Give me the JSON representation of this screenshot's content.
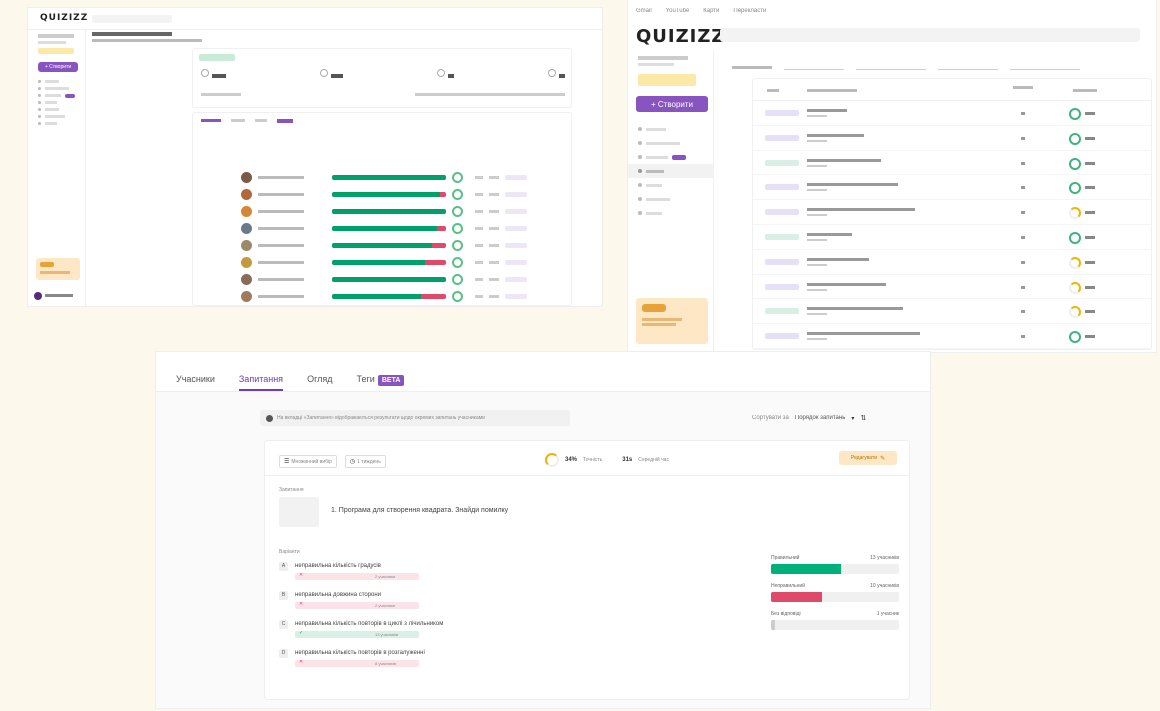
{
  "colors": {
    "brand": "#8854c0",
    "correct": "#00a06a",
    "incorrect": "#e04a6a",
    "background": "#fdf8ec"
  },
  "s1": {
    "logo": "QUIZIZZ",
    "create_label": "+ Створити",
    "students": [
      {
        "bar": 1.0
      },
      {
        "bar": 0.95
      },
      {
        "bar": 1.0
      },
      {
        "bar": 0.92
      },
      {
        "bar": 0.88
      },
      {
        "bar": 0.82
      },
      {
        "bar": 1.0
      },
      {
        "bar": 0.78
      }
    ]
  },
  "s2": {
    "bookmarks": [
      "Gmail",
      "YouTube",
      "Карти",
      "Перекласти"
    ],
    "logo": "QUIZIZZ",
    "create_label": "+ Створити",
    "rows": [
      {
        "acc": 0.9
      },
      {
        "acc": 0.85
      },
      {
        "acc": 0.9
      },
      {
        "acc": 0.85
      },
      {
        "acc": 0.5
      },
      {
        "acc": 0.9
      },
      {
        "acc": 0.55
      },
      {
        "acc": 0.45
      },
      {
        "acc": 0.5
      },
      {
        "acc": 0.95
      }
    ]
  },
  "s3": {
    "tabs": [
      {
        "label": "Учасники"
      },
      {
        "label": "Запитання"
      },
      {
        "label": "Огляд"
      },
      {
        "label": "Теги"
      }
    ],
    "beta": "BETA",
    "notice": "На вкладці «Запитання» відображаються результати щодо окремих запитань учасниками",
    "sort_label": "Сортувати за",
    "sort_value": "Порядок запитань",
    "qtype": "Множинний вибір",
    "qtime": "1 тиждень",
    "accuracy": "34%",
    "accuracy_label": "Точність",
    "avg_time": "31s",
    "avg_time_label": "Середній час",
    "edit_label": "Редагувати",
    "question_label": "Запитання",
    "question_text": "1. Програма для створення квадрата. Знайди помилку",
    "options_label": "Варіанти",
    "options": [
      {
        "letter": "A",
        "text": "неправильна кількість градусів",
        "count": "2 учасники"
      },
      {
        "letter": "B",
        "text": "неправильна довжина сторони",
        "count": "2 учасники"
      },
      {
        "letter": "C",
        "text": "неправильна кількість повторів в циклі з лічильником",
        "count": "13 учасників"
      },
      {
        "letter": "D",
        "text": "неправильна кількість повторів в розгалуженні",
        "count": "8 учасників"
      }
    ],
    "stats": [
      {
        "label": "Правильний",
        "count": "13 учасників"
      },
      {
        "label": "Неправильний",
        "count": "10 учасників"
      },
      {
        "label": "Без відповіді",
        "count": "1 учасник"
      }
    ]
  }
}
